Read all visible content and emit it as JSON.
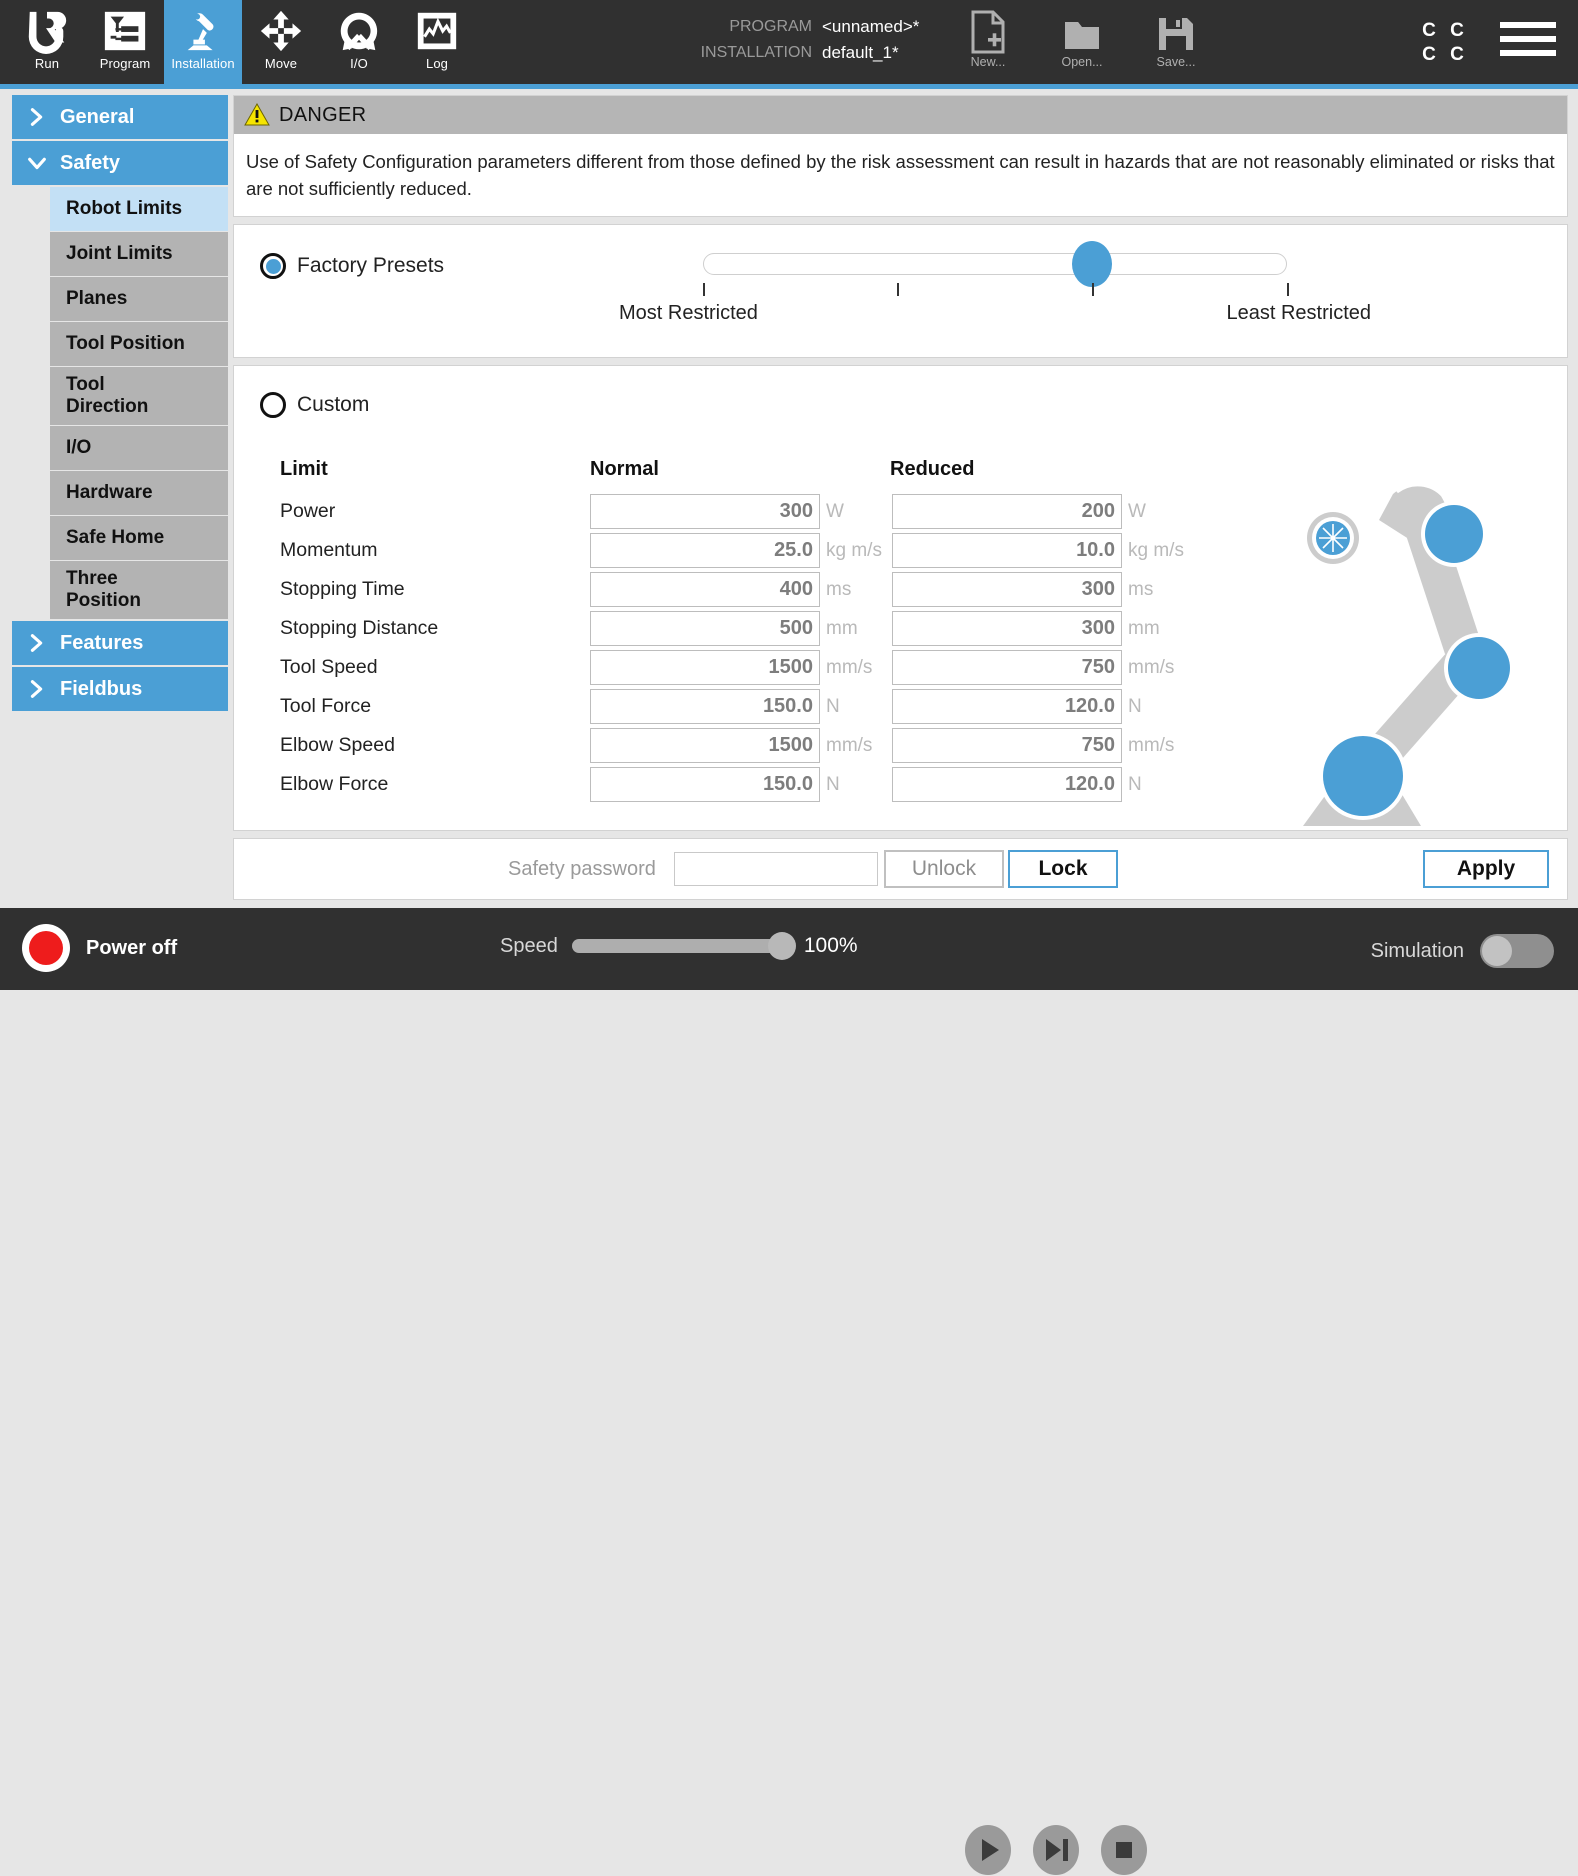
{
  "topbar": {
    "tabs": [
      {
        "label": "Run",
        "icon": "ur-logo-icon",
        "active": false
      },
      {
        "label": "Program",
        "icon": "program-tree-icon",
        "active": false
      },
      {
        "label": "Installation",
        "icon": "robot-arm-icon",
        "active": true
      },
      {
        "label": "Move",
        "icon": "move-arrows-icon",
        "active": false
      },
      {
        "label": "I/O",
        "icon": "io-gauge-icon",
        "active": false
      },
      {
        "label": "Log",
        "icon": "log-graph-icon",
        "active": false
      }
    ],
    "program_key": "PROGRAM",
    "program_value": "<unnamed>*",
    "installation_key": "INSTALLATION",
    "installation_value": "default_1*",
    "file_actions": [
      {
        "label": "New...",
        "icon": "new-file-icon"
      },
      {
        "label": "Open...",
        "icon": "open-folder-icon"
      },
      {
        "label": "Save...",
        "icon": "save-disk-icon"
      }
    ],
    "lang_indicator": [
      "C",
      "C",
      "C",
      "C"
    ],
    "menu_icon": "hamburger-menu-icon"
  },
  "sidebar": {
    "items": [
      {
        "label": "General",
        "type": "group",
        "expanded": false
      },
      {
        "label": "Safety",
        "type": "group",
        "expanded": true
      },
      {
        "label": "Robot Limits",
        "type": "child",
        "selected": true
      },
      {
        "label": "Joint Limits",
        "type": "child",
        "selected": false
      },
      {
        "label": "Planes",
        "type": "child",
        "selected": false
      },
      {
        "label": "Tool Position",
        "type": "child",
        "selected": false
      },
      {
        "label": "Tool\nDirection",
        "type": "child",
        "selected": false
      },
      {
        "label": "I/O",
        "type": "child",
        "selected": false
      },
      {
        "label": "Hardware",
        "type": "child",
        "selected": false
      },
      {
        "label": "Safe Home",
        "type": "child",
        "selected": false
      },
      {
        "label": "Three\nPosition",
        "type": "child",
        "selected": false
      },
      {
        "label": "Features",
        "type": "group",
        "expanded": false
      },
      {
        "label": "Fieldbus",
        "type": "group",
        "expanded": false
      }
    ]
  },
  "danger": {
    "title": "DANGER",
    "icon": "warning-triangle-icon",
    "text": "Use of Safety Configuration parameters different from those defined by the risk assessment can result in hazards that are not reasonably eliminated or risks that are not sufficiently reduced."
  },
  "presets": {
    "radio_label": "Factory Presets",
    "selected": true,
    "slider": {
      "ticks": 4,
      "value_index": 3,
      "low_label": "Most Restricted",
      "high_label": "Least Restricted"
    }
  },
  "custom": {
    "radio_label": "Custom",
    "selected": false,
    "columns": {
      "limit": "Limit",
      "normal": "Normal",
      "reduced": "Reduced"
    },
    "rows": [
      {
        "name": "Power",
        "normal": "300",
        "normal_unit": "W",
        "reduced": "200",
        "reduced_unit": "W"
      },
      {
        "name": "Momentum",
        "normal": "25.0",
        "normal_unit": "kg m/s",
        "reduced": "10.0",
        "reduced_unit": "kg m/s"
      },
      {
        "name": "Stopping Time",
        "normal": "400",
        "normal_unit": "ms",
        "reduced": "300",
        "reduced_unit": "ms"
      },
      {
        "name": "Stopping Distance",
        "normal": "500",
        "normal_unit": "mm",
        "reduced": "300",
        "reduced_unit": "mm"
      },
      {
        "name": "Tool Speed",
        "normal": "1500",
        "normal_unit": "mm/s",
        "reduced": "750",
        "reduced_unit": "mm/s"
      },
      {
        "name": "Tool Force",
        "normal": "150.0",
        "normal_unit": "N",
        "reduced": "120.0",
        "reduced_unit": "N"
      },
      {
        "name": "Elbow Speed",
        "normal": "1500",
        "normal_unit": "mm/s",
        "reduced": "750",
        "reduced_unit": "mm/s"
      },
      {
        "name": "Elbow Force",
        "normal": "150.0",
        "normal_unit": "N",
        "reduced": "120.0",
        "reduced_unit": "N"
      }
    ],
    "robot_graphic": "robot-arm-illustration"
  },
  "actions": {
    "password_placeholder": "Safety password",
    "password_value": "",
    "unlock_label": "Unlock",
    "lock_label": "Lock",
    "apply_label": "Apply"
  },
  "bottombar": {
    "power_label": "Power off",
    "power_state": "off",
    "speed_label": "Speed",
    "speed_value": "100%",
    "transport": [
      {
        "name": "play-button",
        "icon": "play-icon"
      },
      {
        "name": "step-button",
        "icon": "step-icon"
      },
      {
        "name": "stop-button",
        "icon": "stop-icon"
      }
    ],
    "simulation_label": "Simulation",
    "simulation_on": false
  },
  "colors": {
    "accent": "#4b9fd5",
    "dark": "#303030",
    "sidebar_child": "#b3b3b3",
    "selected_child": "#c3e0f5",
    "danger_header": "#b5b5b5",
    "power_red": "#ee1c1c",
    "warning_yellow": "#f5e400"
  }
}
